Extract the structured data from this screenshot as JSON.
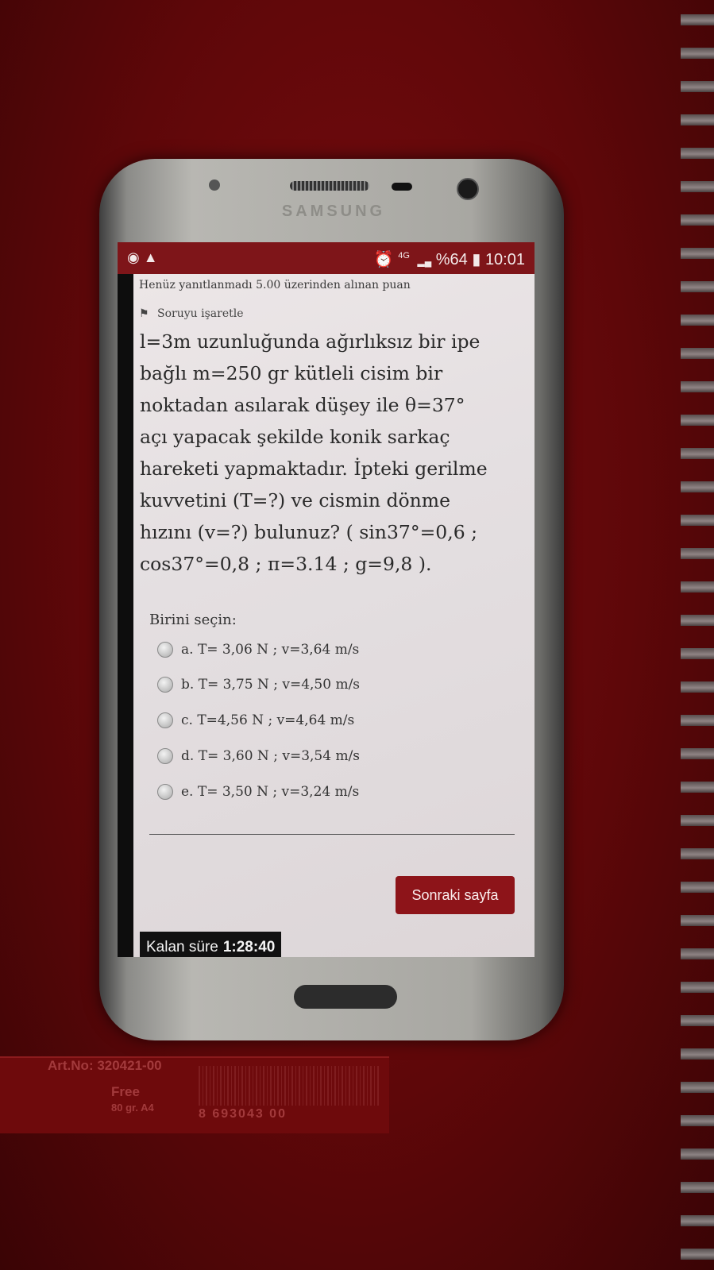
{
  "status_bar": {
    "network": "4G",
    "battery": "%64",
    "time": "10:01"
  },
  "phone": {
    "brand": "SAMSUNG"
  },
  "quiz": {
    "status_text": "Henüz yanıtlanmadı  5.00 üzerinden alınan puan",
    "flag_label": "Soruyu işaretle",
    "question_lines": [
      "l=3m uzunluğunda ağırlıksız bir ipe",
      "bağlı m=250 gr kütleli cisim bir",
      "noktadan asılarak düşey ile θ=37°",
      " açı yapacak şekilde konik sarkaç",
      "hareketi yapmaktadır. İpteki gerilme",
      "kuvvetini (T=?) ve cismin dönme",
      "hızını (v=?) bulunuz? ( sin37°=0,6  ;",
      "cos37°=0,8 ;  π=3.14 ;  g=9,8 )."
    ],
    "choose_label": "Birini seçin:",
    "options": [
      "a. T= 3,06 N  ;  v=3,64 m/s",
      "b. T= 3,75 N  ;   v=4,50 m/s",
      "c. T=4,56 N ;   v=4,64 m/s",
      "d. T= 3,60 N ;  v=3,54 m/s",
      "e. T= 3,50 N  ;  v=3,24 m/s"
    ],
    "next_button": "Sonraki sayfa",
    "timer_label": "Kalan süre",
    "timer_value": "1:28:40"
  },
  "sticker": {
    "art_no": "Art.No: 320421-00",
    "free": "Free",
    "paper": "80 gr. A4",
    "barcode_text": "8 693043 00"
  }
}
